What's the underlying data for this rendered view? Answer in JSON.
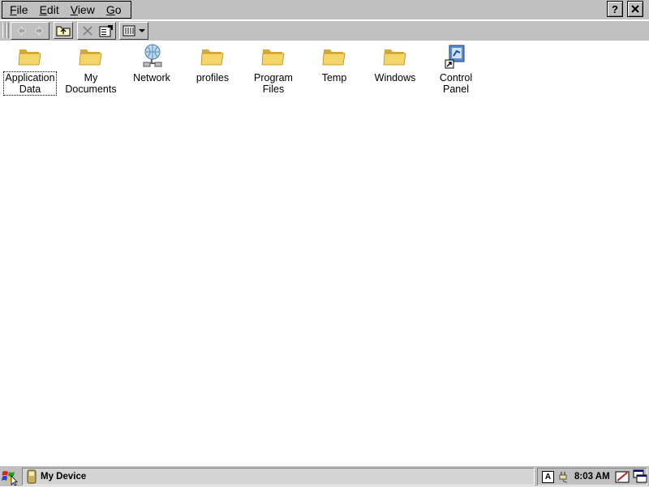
{
  "menubar": {
    "menus": [
      {
        "label": "File",
        "accel": "F",
        "rest": "ile"
      },
      {
        "label": "Edit",
        "accel": "E",
        "rest": "dit"
      },
      {
        "label": "View",
        "accel": "V",
        "rest": "iew"
      },
      {
        "label": "Go",
        "accel": "G",
        "rest": "o"
      }
    ],
    "help_label": "?",
    "close_label": "×"
  },
  "toolbar": {
    "buttons": [
      "back-icon",
      "forward-icon",
      "up-folder-icon",
      "delete-icon",
      "properties-icon",
      "view-mode-icon"
    ]
  },
  "content": {
    "items": [
      {
        "label": "Application\nData",
        "icon": "folder-icon",
        "selected": true
      },
      {
        "label": "My\nDocuments",
        "icon": "folder-icon"
      },
      {
        "label": "Network",
        "icon": "network-icon"
      },
      {
        "label": "profiles",
        "icon": "folder-icon"
      },
      {
        "label": "Program Files",
        "icon": "folder-icon"
      },
      {
        "label": "Temp",
        "icon": "folder-icon"
      },
      {
        "label": "Windows",
        "icon": "folder-icon"
      },
      {
        "label": "Control\nPanel",
        "icon": "control-panel-icon"
      }
    ]
  },
  "taskbar": {
    "task_label": "My Device",
    "input_indicator": "A",
    "clock": "8:03 AM"
  },
  "colors": {
    "face": "#c0c0c0",
    "folder": "#f4d56a",
    "folder_shade": "#d8a93a"
  }
}
